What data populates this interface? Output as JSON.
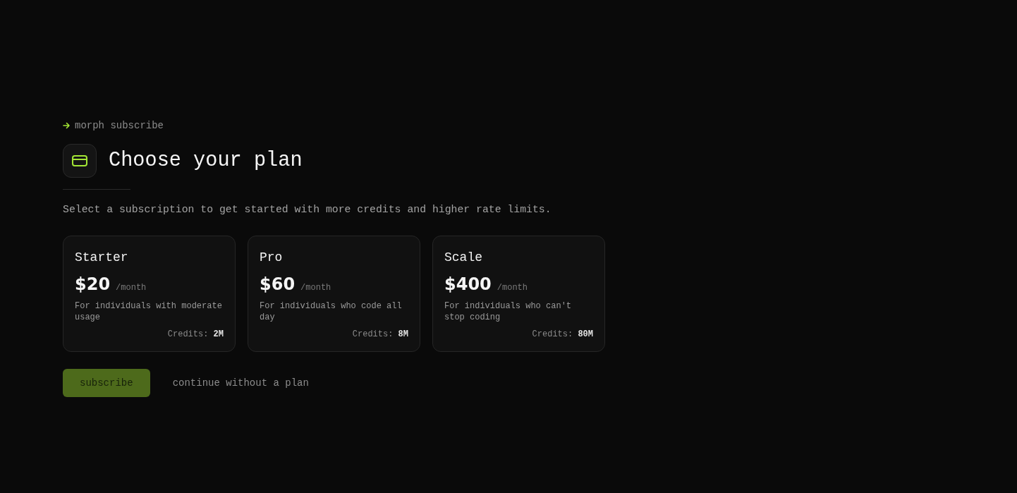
{
  "prompt": {
    "command": "morph subscribe"
  },
  "header": {
    "title": "Choose your plan"
  },
  "description": "Select a subscription to get started with more credits and higher rate limits.",
  "plans": [
    {
      "name": "Starter",
      "price": "$20",
      "period": "/month",
      "description": "For individuals with moderate usage",
      "credits": "Credits: **2M**",
      "selected": false
    },
    {
      "name": "Pro",
      "price": "$60",
      "period": "/month",
      "description": "For individuals who code all day",
      "credits": "Credits: **8M**",
      "selected": false
    },
    {
      "name": "Scale",
      "price": "$400",
      "period": "/month",
      "description": "For individuals who can't stop coding",
      "credits": "Credits: **80M**",
      "selected": false
    }
  ],
  "actions": {
    "subscribe": {
      "label": "subscribe",
      "disabled": true
    },
    "skip": {
      "label": "continue without a plan"
    }
  }
}
